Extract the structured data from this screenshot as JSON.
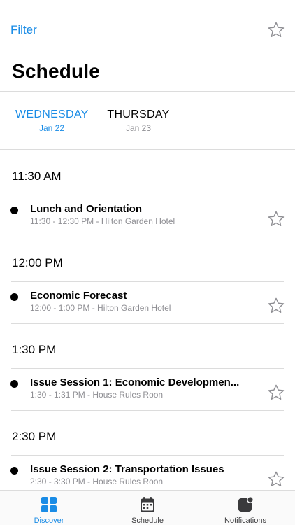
{
  "nav": {
    "filter_label": "Filter",
    "star_icon": "star-outline-icon"
  },
  "page": {
    "title": "Schedule"
  },
  "day_tabs": [
    {
      "day": "WEDNESDAY",
      "date": "Jan 22",
      "active": true
    },
    {
      "day": "THURSDAY",
      "date": "Jan 23",
      "active": false
    }
  ],
  "schedule": [
    {
      "time": "11:30 AM",
      "events": [
        {
          "title": "Lunch and Orientation",
          "detail": "11:30 - 12:30 PM - Hilton Garden Hotel"
        }
      ]
    },
    {
      "time": "12:00 PM",
      "events": [
        {
          "title": "Economic Forecast",
          "detail": "12:00 - 1:00 PM - Hilton Garden Hotel"
        }
      ]
    },
    {
      "time": "1:30 PM",
      "events": [
        {
          "title": "Issue Session 1: Economic Developmen...",
          "detail": "1:30 - 1:31 PM - House Rules Roon"
        }
      ]
    },
    {
      "time": "2:30 PM",
      "events": [
        {
          "title": "Issue Session 2: Transportation Issues",
          "detail": "2:30 - 3:30 PM - House Rules Roon"
        }
      ]
    }
  ],
  "tab_bar": [
    {
      "label": "Discover",
      "icon": "grid-icon",
      "active": true
    },
    {
      "label": "Schedule",
      "icon": "calendar-icon",
      "active": false
    },
    {
      "label": "Notifications",
      "icon": "notification-badge-icon",
      "active": false
    }
  ],
  "colors": {
    "accent": "#1a8ce6",
    "secondary_text": "#8e8e93",
    "divider": "#dcdcdc"
  }
}
